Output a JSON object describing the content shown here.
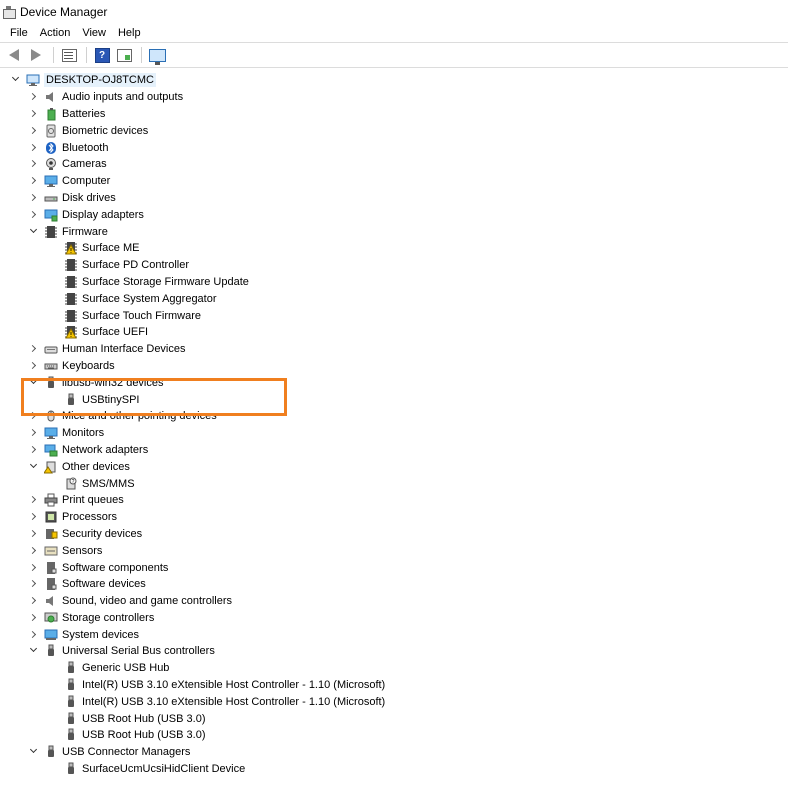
{
  "window": {
    "title": "Device Manager"
  },
  "menu": [
    "File",
    "Action",
    "View",
    "Help"
  ],
  "toolbar": {
    "icons": [
      "back-arrow-icon",
      "forward-arrow-icon",
      "properties-icon",
      "help-icon",
      "update-driver-icon",
      "scan-hardware-icon"
    ],
    "help_glyph": "?"
  },
  "colors": {
    "highlight_box": "#f07f1f",
    "selection": "#e5f1fb",
    "warning": "#f5c400",
    "usb": "#555555"
  },
  "tree": {
    "root": "DESKTOP-OJ8TCMC",
    "rows": [
      {
        "label": "Audio inputs and outputs",
        "level": 1,
        "state": "collapsed",
        "icon": "speaker"
      },
      {
        "label": "Batteries",
        "level": 1,
        "state": "collapsed",
        "icon": "battery"
      },
      {
        "label": "Biometric devices",
        "level": 1,
        "state": "collapsed",
        "icon": "biometric"
      },
      {
        "label": "Bluetooth",
        "level": 1,
        "state": "collapsed",
        "icon": "bluetooth"
      },
      {
        "label": "Cameras",
        "level": 1,
        "state": "collapsed",
        "icon": "camera"
      },
      {
        "label": "Computer",
        "level": 1,
        "state": "collapsed",
        "icon": "monitor"
      },
      {
        "label": "Disk drives",
        "level": 1,
        "state": "collapsed",
        "icon": "disk"
      },
      {
        "label": "Display adapters",
        "level": 1,
        "state": "collapsed",
        "icon": "display"
      },
      {
        "label": "Firmware",
        "level": 1,
        "state": "expanded",
        "icon": "chip"
      },
      {
        "label": "Surface ME",
        "level": 2,
        "icon": "chip-warn"
      },
      {
        "label": "Surface PD Controller",
        "level": 2,
        "icon": "chip"
      },
      {
        "label": "Surface Storage Firmware Update",
        "level": 2,
        "icon": "chip"
      },
      {
        "label": "Surface System Aggregator",
        "level": 2,
        "icon": "chip"
      },
      {
        "label": "Surface Touch Firmware",
        "level": 2,
        "icon": "chip"
      },
      {
        "label": "Surface UEFI",
        "level": 2,
        "icon": "chip-warn"
      },
      {
        "label": "Human Interface Devices",
        "level": 1,
        "state": "collapsed",
        "icon": "hid"
      },
      {
        "label": "Keyboards",
        "level": 1,
        "state": "collapsed",
        "icon": "keyboard"
      },
      {
        "label": "libusb-win32 devices",
        "level": 1,
        "state": "expanded",
        "icon": "usb"
      },
      {
        "label": "USBtinySPI",
        "level": 2,
        "icon": "usb"
      },
      {
        "label": "Mice and other pointing devices",
        "level": 1,
        "state": "collapsed",
        "icon": "mouse"
      },
      {
        "label": "Monitors",
        "level": 1,
        "state": "collapsed",
        "icon": "monitor"
      },
      {
        "label": "Network adapters",
        "level": 1,
        "state": "collapsed",
        "icon": "network"
      },
      {
        "label": "Other devices",
        "level": 1,
        "state": "expanded",
        "icon": "other"
      },
      {
        "label": "SMS/MMS",
        "level": 2,
        "icon": "unknown"
      },
      {
        "label": "Print queues",
        "level": 1,
        "state": "collapsed",
        "icon": "printer"
      },
      {
        "label": "Processors",
        "level": 1,
        "state": "collapsed",
        "icon": "cpu"
      },
      {
        "label": "Security devices",
        "level": 1,
        "state": "collapsed",
        "icon": "security"
      },
      {
        "label": "Sensors",
        "level": 1,
        "state": "collapsed",
        "icon": "sensor"
      },
      {
        "label": "Software components",
        "level": 1,
        "state": "collapsed",
        "icon": "software"
      },
      {
        "label": "Software devices",
        "level": 1,
        "state": "collapsed",
        "icon": "software"
      },
      {
        "label": "Sound, video and game controllers",
        "level": 1,
        "state": "collapsed",
        "icon": "speaker"
      },
      {
        "label": "Storage controllers",
        "level": 1,
        "state": "collapsed",
        "icon": "storage"
      },
      {
        "label": "System devices",
        "level": 1,
        "state": "collapsed",
        "icon": "system"
      },
      {
        "label": "Universal Serial Bus controllers",
        "level": 1,
        "state": "expanded",
        "icon": "usb"
      },
      {
        "label": "Generic USB Hub",
        "level": 2,
        "icon": "usb"
      },
      {
        "label": "Intel(R) USB 3.10 eXtensible Host Controller - 1.10 (Microsoft)",
        "level": 2,
        "icon": "usb"
      },
      {
        "label": "Intel(R) USB 3.10 eXtensible Host Controller - 1.10 (Microsoft)",
        "level": 2,
        "icon": "usb"
      },
      {
        "label": "USB Root Hub (USB 3.0)",
        "level": 2,
        "icon": "usb"
      },
      {
        "label": "USB Root Hub (USB 3.0)",
        "level": 2,
        "icon": "usb"
      },
      {
        "label": "USB Connector Managers",
        "level": 1,
        "state": "expanded",
        "icon": "usb"
      },
      {
        "label": "SurfaceUcmUcsiHidClient Device",
        "level": 2,
        "icon": "usb"
      }
    ]
  }
}
